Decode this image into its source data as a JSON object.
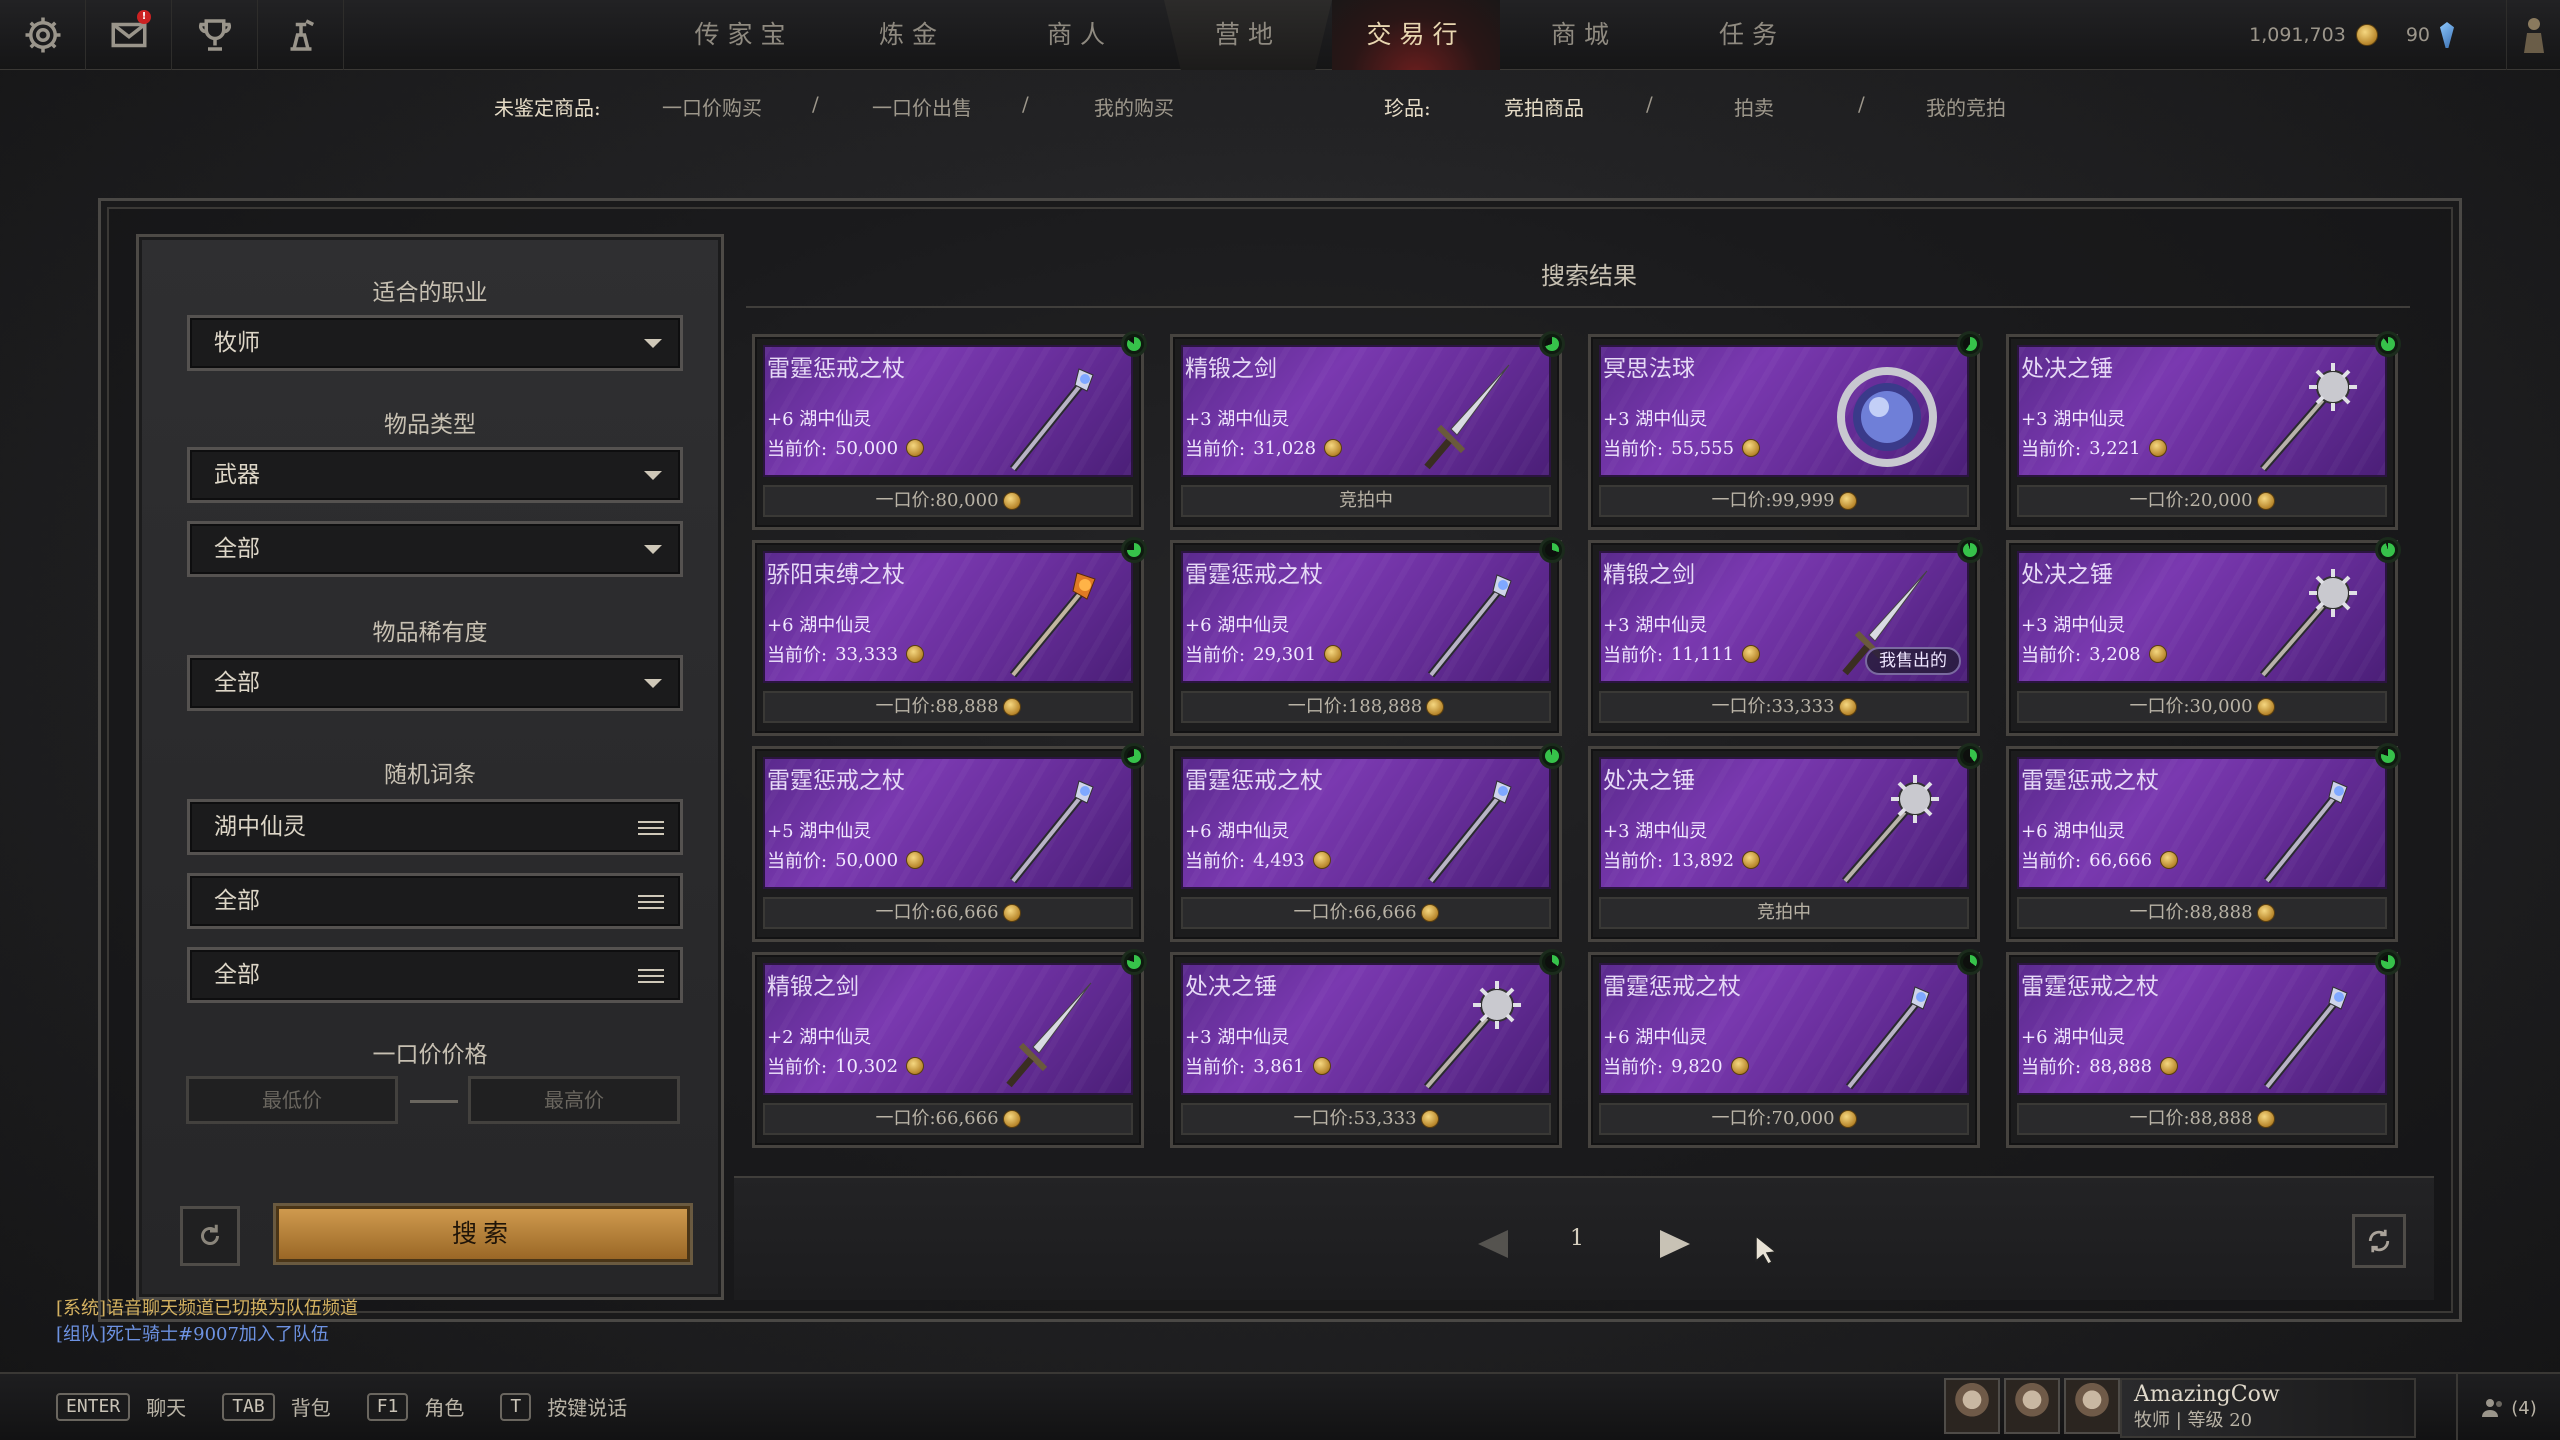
{
  "topbar": {
    "icons": [
      "settings-icon",
      "mail-icon",
      "trophy-icon",
      "alchemy-icon"
    ],
    "mail_badge": "!",
    "tabs": [
      "传家宝",
      "炼金",
      "商人",
      "营地",
      "交易行",
      "商城",
      "任务"
    ],
    "active_tab": "交易行",
    "gold": "1,091,703",
    "premium": "90"
  },
  "subnav": {
    "unidentified_label": "未鉴定商品:",
    "buyout_buy": "一口价购买",
    "buyout_sell": "一口价出售",
    "my_purchases": "我的购买",
    "rare_label": "珍品:",
    "auction_items": "竞拍商品",
    "auction": "拍卖",
    "my_bids": "我的竞拍",
    "sep": "/"
  },
  "filters": {
    "class_title": "适合的职业",
    "class_value": "牧师",
    "item_type_title": "物品类型",
    "item_type_value": "武器",
    "item_subtype_value": "全部",
    "rarity_title": "物品稀有度",
    "rarity_value": "全部",
    "affix_title": "随机词条",
    "affix1": "湖中仙灵",
    "affix2": "全部",
    "affix3": "全部",
    "price_title": "一口价价格",
    "min_placeholder": "最低价",
    "max_placeholder": "最高价",
    "search_label": "搜索"
  },
  "results": {
    "title": "搜索结果",
    "cur_label": "当前价:",
    "buyout_label": "一口价:",
    "items": [
      {
        "name": "雷霆惩戒之杖",
        "affix": "+6 湖中仙灵",
        "current": "50,000",
        "buyout": "80,000",
        "weapon": "staff",
        "bidding": false,
        "timer": 85
      },
      {
        "name": "精锻之剑",
        "affix": "+3 湖中仙灵",
        "current": "31,028",
        "buyout": "",
        "bottom_text": "竞拍中",
        "weapon": "sword",
        "bidding": true,
        "timer": 70
      },
      {
        "name": "冥思法球",
        "affix": "+3 湖中仙灵",
        "current": "55,555",
        "buyout": "99,999",
        "weapon": "orb",
        "bidding": false,
        "timer": 60
      },
      {
        "name": "处决之锤",
        "affix": "+3 湖中仙灵",
        "current": "3,221",
        "buyout": "20,000",
        "weapon": "mace",
        "bidding": false,
        "timer": 90
      },
      {
        "name": "骄阳束缚之杖",
        "affix": "+6 湖中仙灵",
        "current": "33,333",
        "buyout": "88,888",
        "weapon": "firestaff",
        "bidding": false,
        "timer": 75
      },
      {
        "name": "雷霆惩戒之杖",
        "affix": "+6 湖中仙灵",
        "current": "29,301",
        "buyout": "188,888",
        "weapon": "staff",
        "bidding": false,
        "timer": 30
      },
      {
        "name": "精锻之剑",
        "affix": "+3 湖中仙灵",
        "current": "11,111",
        "buyout": "33,333",
        "weapon": "sword",
        "bidding": false,
        "timer": 95,
        "badge": "我售出的"
      },
      {
        "name": "处决之锤",
        "affix": "+3 湖中仙灵",
        "current": "3,208",
        "buyout": "30,000",
        "weapon": "mace",
        "bidding": false,
        "timer": 95
      },
      {
        "name": "雷霆惩戒之杖",
        "affix": "+5 湖中仙灵",
        "current": "50,000",
        "buyout": "66,666",
        "weapon": "staff",
        "bidding": false,
        "timer": 70
      },
      {
        "name": "雷霆惩戒之杖",
        "affix": "+6 湖中仙灵",
        "current": "4,493",
        "buyout": "66,666",
        "weapon": "staff",
        "bidding": false,
        "timer": 95
      },
      {
        "name": "处决之锤",
        "affix": "+3 湖中仙灵",
        "current": "13,892",
        "buyout": "",
        "bottom_text": "竞拍中",
        "weapon": "mace",
        "bidding": true,
        "timer": 40
      },
      {
        "name": "雷霆惩戒之杖",
        "affix": "+6 湖中仙灵",
        "current": "66,666",
        "buyout": "88,888",
        "weapon": "staff",
        "bidding": false,
        "timer": 80
      },
      {
        "name": "精锻之剑",
        "affix": "+2 湖中仙灵",
        "current": "10,302",
        "buyout": "66,666",
        "weapon": "sword",
        "bidding": false,
        "timer": 80
      },
      {
        "name": "处决之锤",
        "affix": "+3 湖中仙灵",
        "current": "3,861",
        "buyout": "53,333",
        "weapon": "mace",
        "bidding": false,
        "timer": 35
      },
      {
        "name": "雷霆惩戒之杖",
        "affix": "+6 湖中仙灵",
        "current": "9,820",
        "buyout": "70,000",
        "weapon": "staff",
        "bidding": false,
        "timer": 35
      },
      {
        "name": "雷霆惩戒之杖",
        "affix": "+6 湖中仙灵",
        "current": "88,888",
        "buyout": "88,888",
        "weapon": "staff",
        "bidding": false,
        "timer": 80
      }
    ]
  },
  "pager": {
    "page": "1"
  },
  "chat": {
    "line1": "[系统]语音聊天频道已切换为队伍频道",
    "line2": "[组队]死亡骑士#9007加入了队伍"
  },
  "bottombar": {
    "hotkeys": [
      {
        "key": "ENTER",
        "label": "聊天"
      },
      {
        "key": "TAB",
        "label": "背包"
      },
      {
        "key": "F1",
        "label": "角色"
      },
      {
        "key": "T",
        "label": "按键说话"
      }
    ],
    "player_name": "AmazingCow",
    "player_info": "牧师 | 等级 20",
    "friends_count": "(4)"
  },
  "colors": {
    "item_purple": "#6a2f9d",
    "gold": "#d9a94a",
    "active_tab_red": "#6b1e1e",
    "timer_green": "#36c24a",
    "chat_system": "#d4b160",
    "chat_team": "#6d92e2"
  }
}
